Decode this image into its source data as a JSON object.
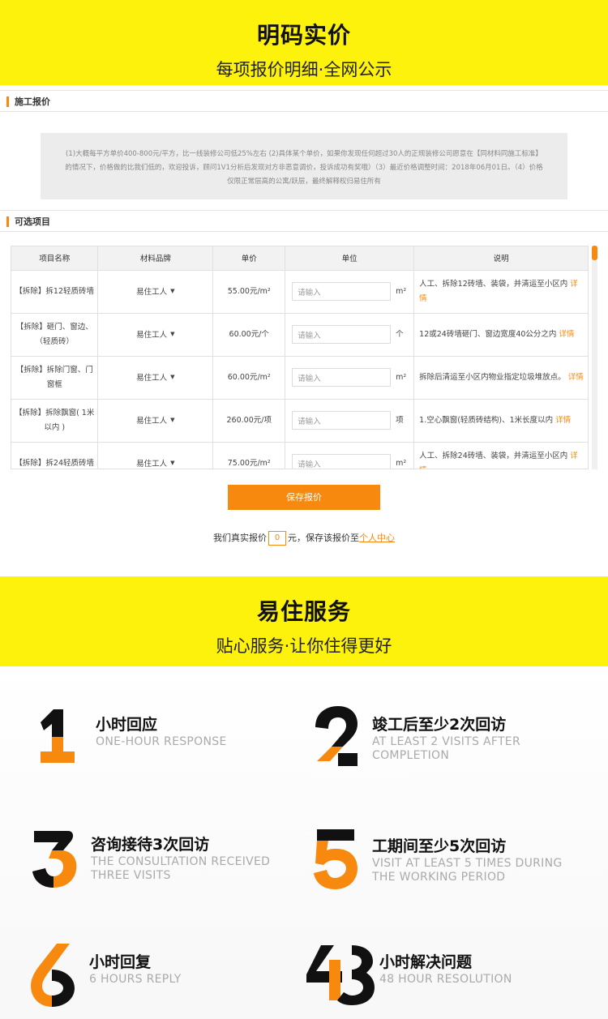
{
  "hero1": {
    "title": "明码实价",
    "subtitle": "每项报价明细·全网公示"
  },
  "section_construction": {
    "title": "施工报价"
  },
  "notice": "(1)大概每平方单价400-800元/平方，比一线装修公司低25%左右 (2)具体某个单价，如果你发现任何超过30人的正规装修公司愿意在【同材料同施工标准】的情况下，价格做的比我们低的，欢迎投诉，顾问1V1分析后发现对方非恶意调价，投诉成功有奖哦）（3）最近价格调整时间：2018年06月01日。（4）价格仅限正常层高的公寓/跃层，最终解释权归易住所有",
  "section_optional": {
    "title": "可选项目"
  },
  "table": {
    "headers": [
      "项目名称",
      "材料品牌",
      "单价",
      "单位",
      "说明"
    ],
    "input_placeholder": "请输入",
    "detail_label": "详情",
    "rows": [
      {
        "name": "【拆除】拆12轻质砖墙",
        "brand": "易住工人",
        "price": "55.00元/m²",
        "unit": "m²",
        "desc": "人工、拆除12砖墙、装袋，并清运至小区内"
      },
      {
        "name": "【拆除】砸门、窗边、（轻质砖）",
        "brand": "易住工人",
        "price": "60.00元/个",
        "unit": "个",
        "desc": "12或24砖墙砸门、窗边宽度40公分之内"
      },
      {
        "name": "【拆除】拆除门窗、门窗框",
        "brand": "易住工人",
        "price": "60.00元/m²",
        "unit": "m²",
        "desc": "拆除后清运至小区内物业指定垃圾堆放点。"
      },
      {
        "name": "【拆除】拆除飘窗( 1米以内 )",
        "brand": "易住工人",
        "price": "260.00元/项",
        "unit": "项",
        "desc": "1.空心飘窗(轻质砖结构)、1米长度以内"
      },
      {
        "name": "【拆除】拆24轻质砖墙",
        "brand": "易住工人",
        "price": "75.00元/m²",
        "unit": "m²",
        "desc": "人工、拆除24砖墙、装袋，并清运至小区内"
      }
    ]
  },
  "save_button": "保存报价",
  "total": {
    "prefix": "我们真实报价",
    "value": "0",
    "suffix": "元，保存该报价至",
    "link": "个人中心"
  },
  "hero2": {
    "title": "易住服务",
    "subtitle": "贴心服务·让你住得更好"
  },
  "services": [
    {
      "number": "1",
      "title": "小时回应",
      "sub": "ONE-HOUR RESPONSE"
    },
    {
      "number": "2",
      "title": "竣工后至少2次回访",
      "sub": "AT LEAST 2 VISITS AFTER COMPLETION"
    },
    {
      "number": "3",
      "title": "咨询接待3次回访",
      "sub": "THE CONSULTATION  RECEIVED THREE VISITS"
    },
    {
      "number": "5",
      "title": "工期间至少5次回访",
      "sub": "VISIT AT LEAST 5 TIMES DURING THE WORKING PERIOD"
    },
    {
      "number": "6",
      "title": "小时回复",
      "sub": "6 HOURS REPLY"
    },
    {
      "number": "48",
      "title": "小时解决问题",
      "sub": "48 HOUR RESOLUTION"
    }
  ],
  "colors": {
    "accent": "#f7890f",
    "banner": "#fdf20c",
    "dark": "#111111"
  }
}
